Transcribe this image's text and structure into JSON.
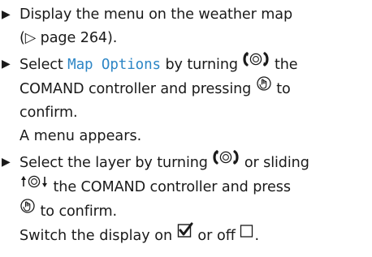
{
  "steps": [
    {
      "bullet": "▶",
      "line1": "Display the menu on the weather map",
      "line2": "(▷ page 264)."
    },
    {
      "bullet": "▶",
      "part1": "Select ",
      "highlight": "Map Options",
      "part2": " by turning ",
      "part3": " the",
      "line2": "COMAND controller and pressing ",
      "part4": " to",
      "line3": "confirm.",
      "result": "A menu appears."
    },
    {
      "bullet": "▶",
      "part1": "Select the layer by turning ",
      "part2": " or sliding",
      "part3": " the COMAND controller and press",
      "part4": " to confirm.",
      "result_part1": "Switch the display on ",
      "result_part2": " or off ",
      "result_part3": "."
    }
  ],
  "colors": {
    "highlight": "#2d86c6",
    "text": "#1a1a1a"
  },
  "icons": [
    "play-bullet-icon",
    "controller-turn-icon",
    "controller-press-icon",
    "controller-slide-icon",
    "checkbox-checked-icon",
    "checkbox-empty-icon"
  ]
}
